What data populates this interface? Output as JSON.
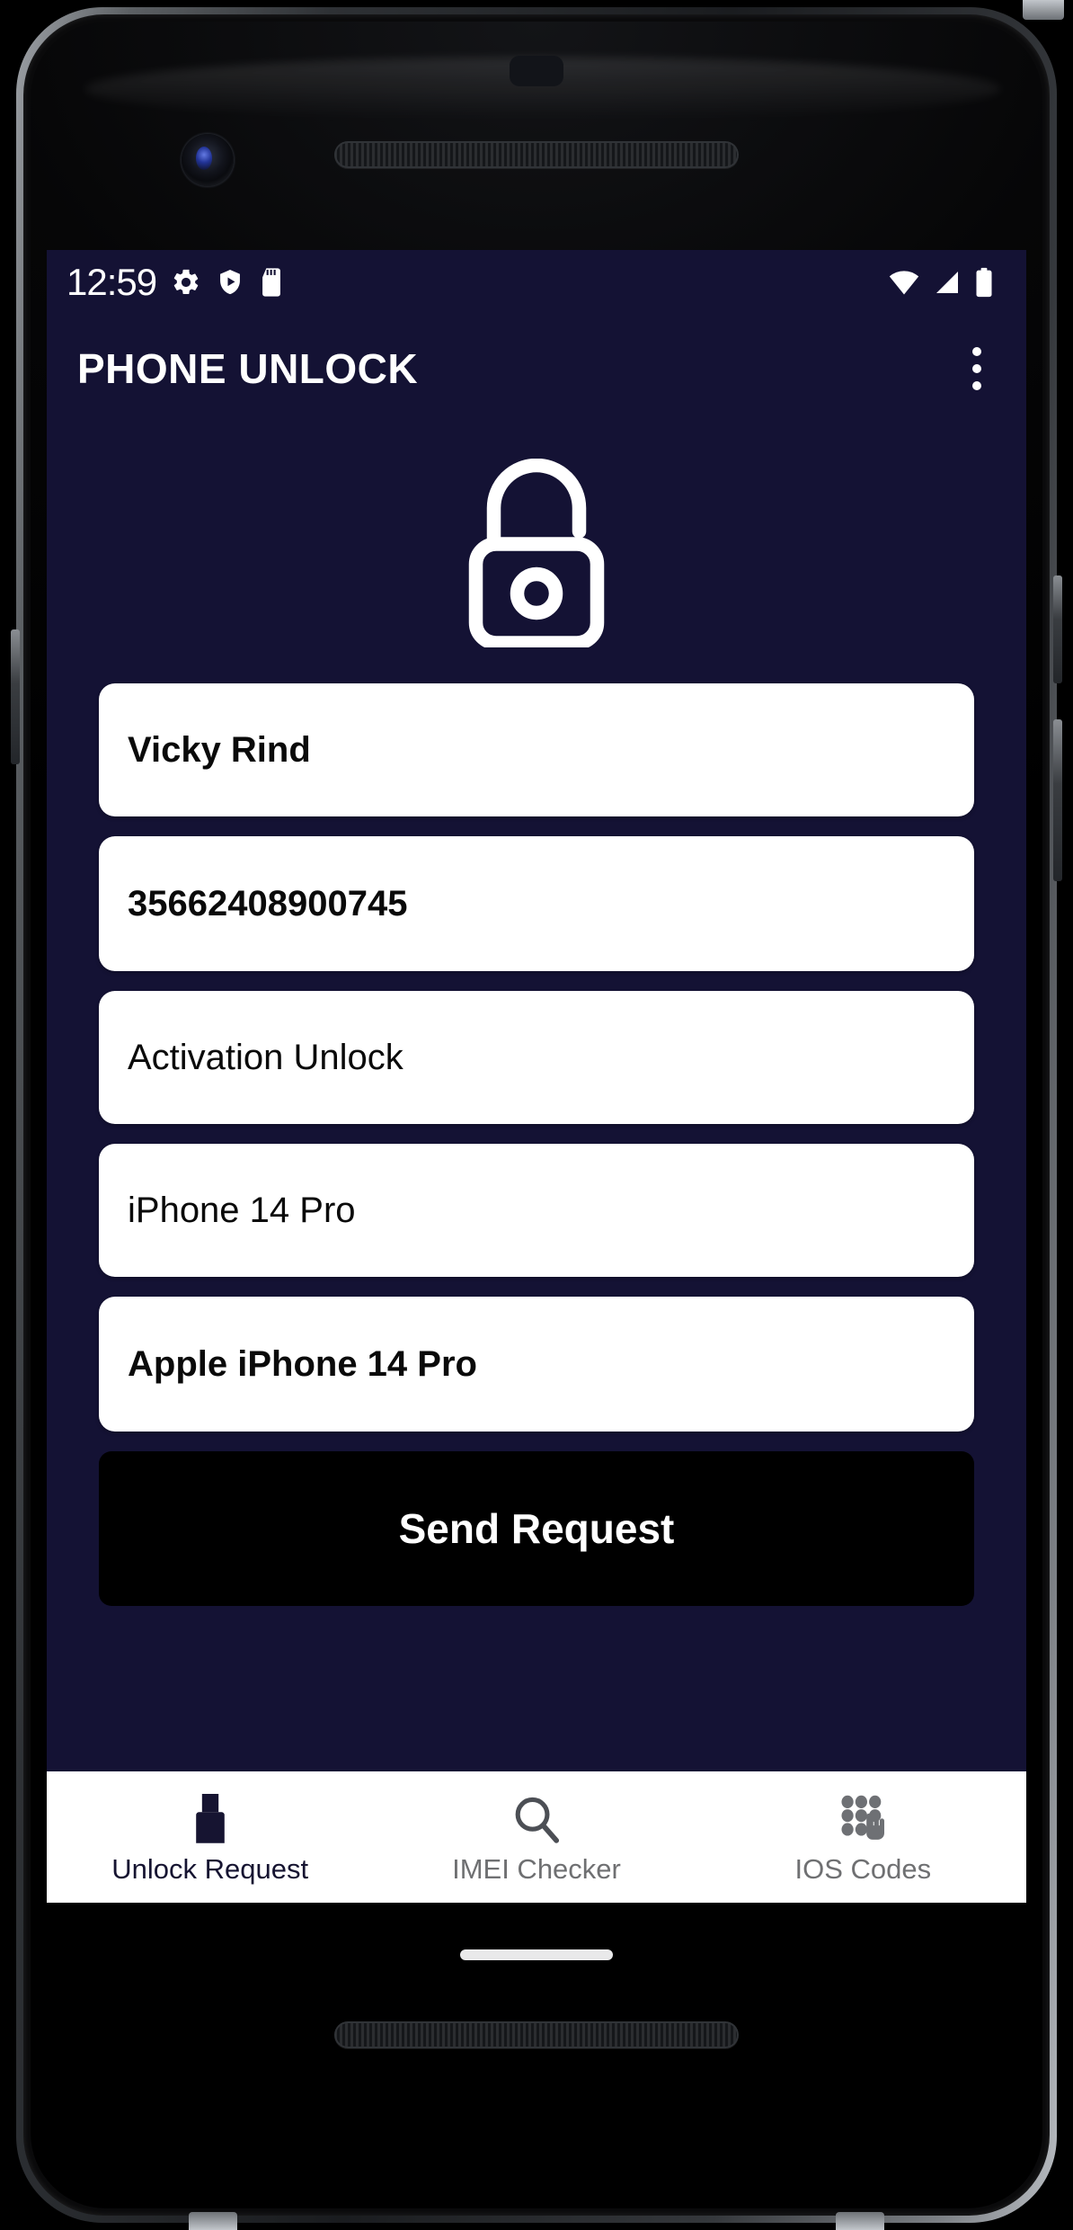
{
  "device": {
    "frame": "smartphone-mockup",
    "sensors": [
      "front-camera",
      "earpiece-speaker",
      "proximity-sensor",
      "bottom-speaker"
    ]
  },
  "status_bar": {
    "time": "12:59",
    "left_icons": [
      "gear-icon",
      "shield-play-icon",
      "sd-card-icon"
    ],
    "right_icons": [
      "wifi-icon",
      "cellular-signal-icon",
      "battery-icon"
    ]
  },
  "app_bar": {
    "title": "PHONE UNLOCK",
    "overflow_menu": "overflow-menu-icon"
  },
  "hero": {
    "icon": "open-padlock-icon"
  },
  "form": {
    "fields": [
      {
        "name": "customer-name",
        "value": "Vicky Rind",
        "bold": true
      },
      {
        "name": "imei-number",
        "value": "35662408900745",
        "bold": true
      },
      {
        "name": "unlock-service",
        "value": "Activation Unlock",
        "bold": false
      },
      {
        "name": "device-model",
        "value": "iPhone 14 Pro",
        "bold": false
      },
      {
        "name": "device-brand-model",
        "value": "Apple iPhone 14 Pro",
        "bold": true
      }
    ],
    "submit_label": "Send Request"
  },
  "bottom_nav": {
    "items": [
      {
        "label": "Unlock Request",
        "icon": "padlock-icon",
        "active": true
      },
      {
        "label": "IMEI Checker",
        "icon": "magnifier-icon",
        "active": false
      },
      {
        "label": "IOS Codes",
        "icon": "keypad-hand-icon",
        "active": false
      }
    ]
  },
  "colors": {
    "screen_background": "#141234",
    "field_background": "#ffffff",
    "submit_background": "#000000",
    "nav_background": "#ffffff",
    "nav_active": "#161431",
    "nav_idle": "#6f7072",
    "text_on_dark": "#ffffff"
  },
  "gesture_bar": "home-indicator"
}
